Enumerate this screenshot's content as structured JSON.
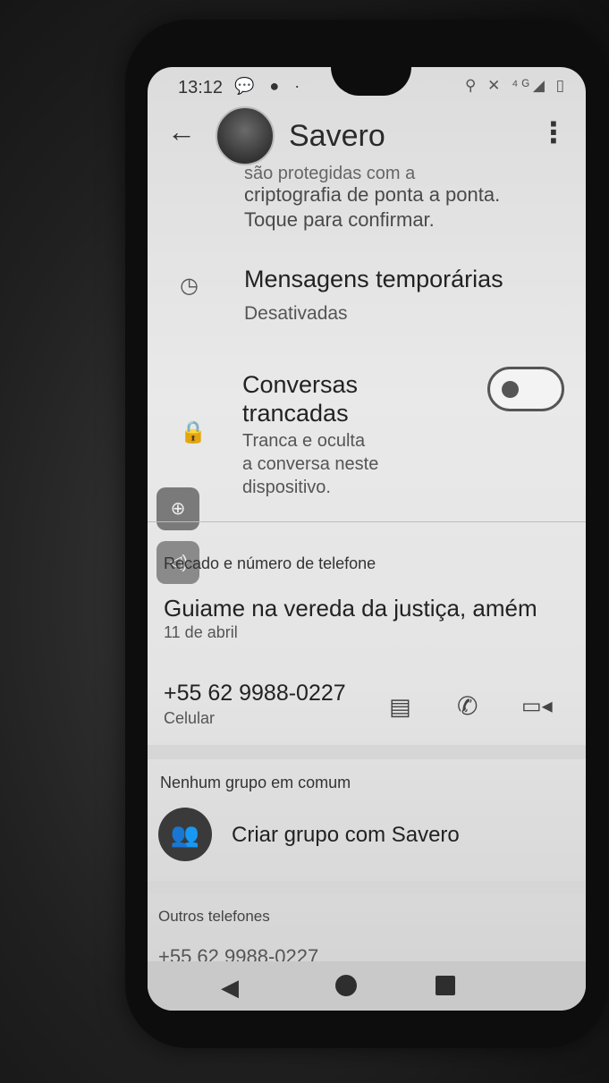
{
  "status_bar": {
    "time": "13:12",
    "left_icons": "💬 ● ·",
    "right_icons": "⚲ ✕ ⁴ᴳ◢ ▯"
  },
  "header": {
    "back_icon": "←",
    "contact_name": "Savero",
    "menu_icon": "⋮"
  },
  "encryption": {
    "clipped_line": "são protegidas com a",
    "line1": "criptografia de ponta a ponta.",
    "line2": "Toque para confirmar."
  },
  "temporary_messages": {
    "icon": "◷",
    "title": "Mensagens temporárias",
    "subtitle": "Desativadas"
  },
  "locked_chats": {
    "icon": "🔒",
    "title_line1": "Conversas",
    "title_line2": "trancadas",
    "sub_line1": "Tranca e oculta",
    "sub_line2": "a conversa neste",
    "sub_line3": "dispositivo.",
    "toggle_state": "off"
  },
  "overlay_buttons": {
    "zoom_icon": "⊕",
    "sound_icon": "◁)"
  },
  "about": {
    "section_label": "Recado e número de telefone",
    "status_text": "Guiame na vereda da justiça, amém",
    "status_date": "11 de abril"
  },
  "phone": {
    "number": "+55 62 9988-0227",
    "type": "Celular",
    "message_icon": "▤",
    "call_icon": "✆",
    "video_icon": "▭◂"
  },
  "groups": {
    "section_label": "Nenhum grupo em comum",
    "create_icon": "👥",
    "create_label": "Criar grupo com Savero"
  },
  "other_phones": {
    "section_label": "Outros telefones",
    "clipped_number": "+55 62 9988-0227"
  },
  "nav": {
    "back_icon": "◀"
  }
}
